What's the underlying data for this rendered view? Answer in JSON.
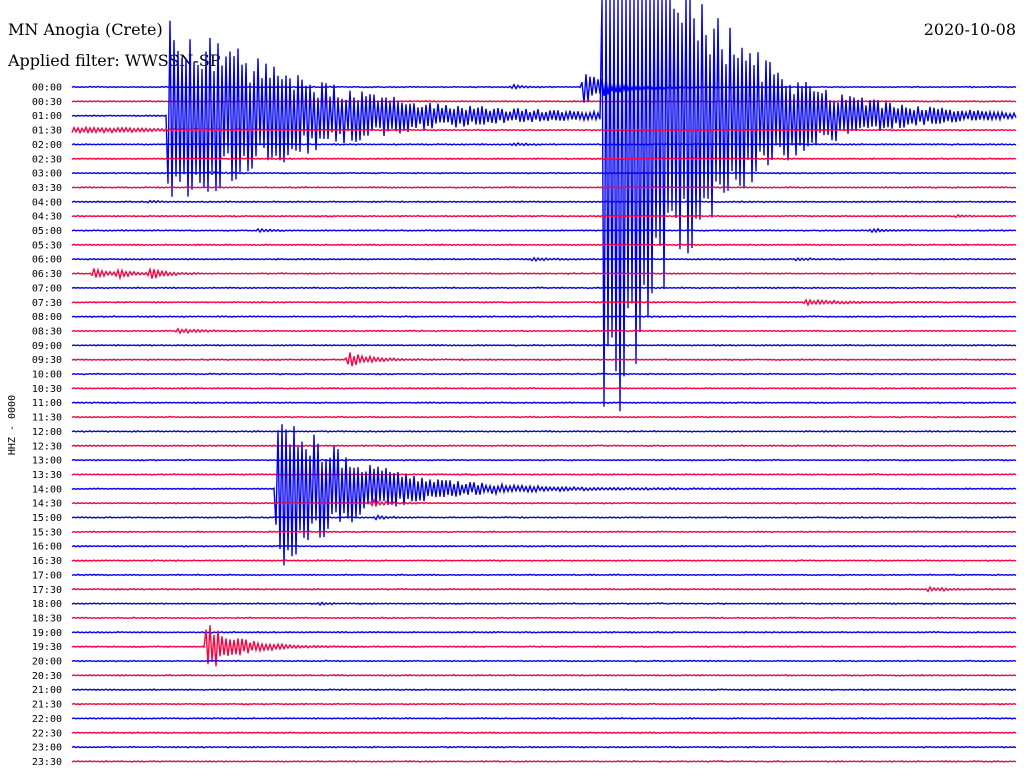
{
  "header": {
    "station": "MN Anogia (Crete)",
    "date": "2020-10-08",
    "filter": "Applied filter: WWSSN-SP"
  },
  "chart_data": {
    "type": "line",
    "subtype": "helicorder",
    "ylabel": "HHZ - 0000",
    "y_tick_labels": [
      "00:00",
      "00:30",
      "01:00",
      "01:30",
      "02:00",
      "02:30",
      "03:00",
      "03:30",
      "04:00",
      "04:30",
      "05:00",
      "05:30",
      "06:00",
      "06:30",
      "07:00",
      "07:30",
      "08:00",
      "08:30",
      "09:00",
      "09:30",
      "10:00",
      "10:30",
      "11:00",
      "11:30",
      "12:00",
      "12:30",
      "13:00",
      "13:30",
      "14:00",
      "14:30",
      "15:00",
      "15:30",
      "16:00",
      "16:30",
      "17:00",
      "17:30",
      "18:00",
      "18:30",
      "19:00",
      "19:30",
      "20:00",
      "20:30",
      "21:00",
      "21:30",
      "22:00",
      "22:30",
      "23:00",
      "23:30"
    ],
    "row_colors": [
      "#0000ee",
      "#ff0040"
    ],
    "noise_level": 0.5,
    "events": [
      {
        "row": 0,
        "frac": 0.465,
        "amp": 3.0,
        "decay": 0.01
      },
      {
        "row": 0,
        "frac": 0.54,
        "amp": 20.0,
        "decay": 0.03
      },
      {
        "row": 4,
        "frac": 0.465,
        "amp": 2.0,
        "decay": 0.012
      },
      {
        "row": 6,
        "frac": 0.145,
        "amp": 1.5,
        "decay": 0.012
      },
      {
        "row": 8,
        "frac": 0.08,
        "amp": 1.0,
        "decay": 0.01
      },
      {
        "row": 9,
        "frac": 0.935,
        "amp": 1.5,
        "decay": 0.008
      },
      {
        "row": 10,
        "frac": 0.195,
        "amp": 2.0,
        "decay": 0.012
      },
      {
        "row": 10,
        "frac": 0.845,
        "amp": 2.5,
        "decay": 0.012
      },
      {
        "row": 12,
        "frac": 0.485,
        "amp": 1.5,
        "decay": 0.02
      },
      {
        "row": 12,
        "frac": 0.765,
        "amp": 2.0,
        "decay": 0.012
      },
      {
        "row": 13,
        "frac": 0.02,
        "amp": 6.0,
        "decay": 0.015
      },
      {
        "row": 13,
        "frac": 0.045,
        "amp": 5.0,
        "decay": 0.015
      },
      {
        "row": 13,
        "frac": 0.08,
        "amp": 7.0,
        "decay": 0.015
      },
      {
        "row": 15,
        "frac": 0.775,
        "amp": 2.5,
        "decay": 0.04
      },
      {
        "row": 17,
        "frac": 0.11,
        "amp": 3.0,
        "decay": 0.02
      },
      {
        "row": 19,
        "frac": 0.29,
        "amp": 8.0,
        "decay": 0.025
      },
      {
        "row": 2,
        "frac": 0.1,
        "amp": 120.0,
        "decay": 0.13
      },
      {
        "row": 2,
        "frac": 0.56,
        "amp": 400.0,
        "decay": 0.09
      },
      {
        "row": 28,
        "frac": 0.215,
        "amp": 100.0,
        "decay": 0.075
      },
      {
        "row": 29,
        "frac": 0.315,
        "amp": 4.0,
        "decay": 0.015
      },
      {
        "row": 30,
        "frac": 0.32,
        "amp": 2.5,
        "decay": 0.012
      },
      {
        "row": 35,
        "frac": 0.905,
        "amp": 3.5,
        "decay": 0.015
      },
      {
        "row": 36,
        "frac": 0.26,
        "amp": 1.5,
        "decay": 0.012
      },
      {
        "row": 39,
        "frac": 0.14,
        "amp": 30.0,
        "decay": 0.03
      }
    ]
  }
}
